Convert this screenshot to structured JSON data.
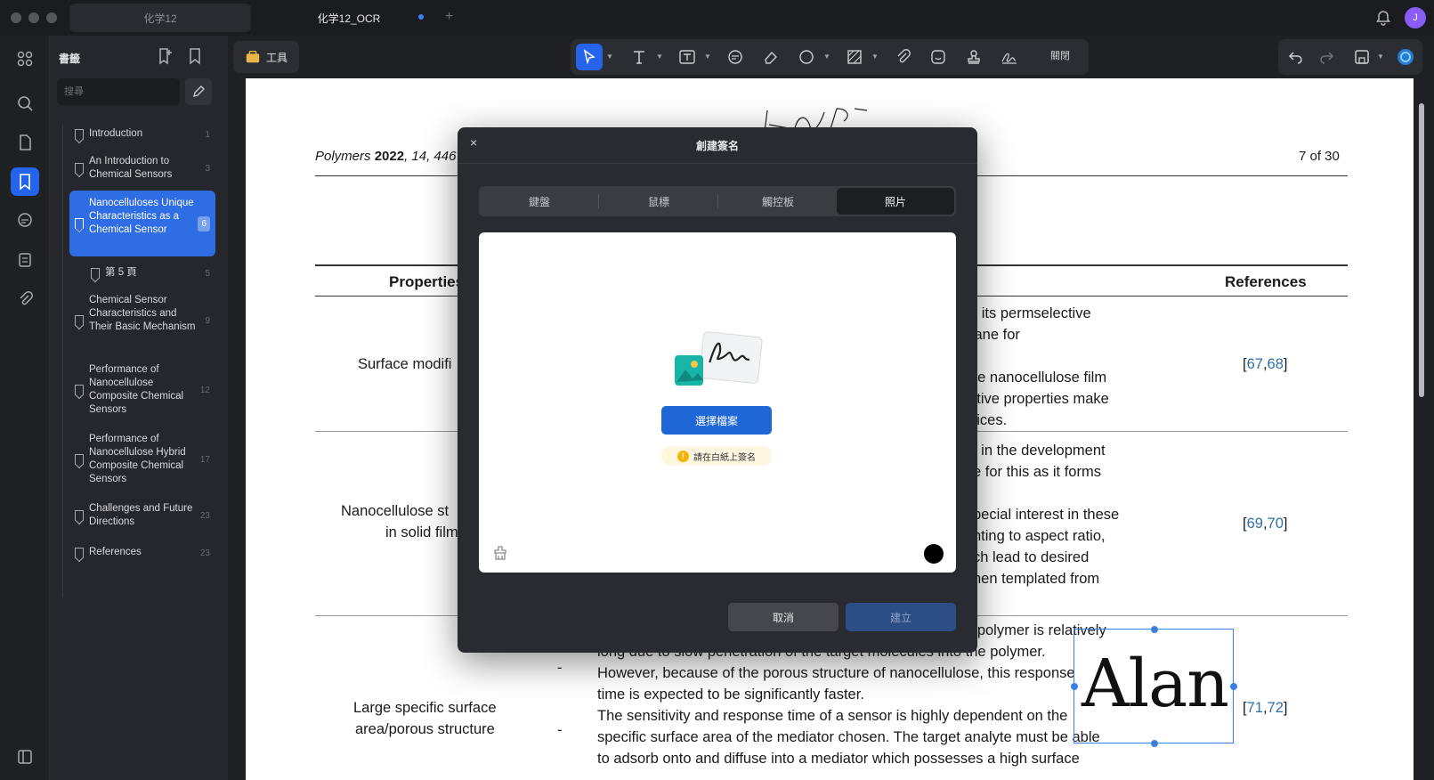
{
  "titlebar": {
    "tabs": [
      {
        "label": "化学12"
      },
      {
        "label": "化学12_OCR"
      }
    ],
    "avatar_initial": "J"
  },
  "sidebar": {
    "title": "書籤",
    "search_placeholder": "搜尋",
    "bookmarks": [
      {
        "label": "Introduction",
        "page": "1"
      },
      {
        "label": "An Introduction to Chemical Sensors",
        "page": "3"
      },
      {
        "label": "Nanocelluloses Unique Characteristics as a Chemical Sensor",
        "page": "6"
      },
      {
        "label": "第 5 頁",
        "page": "5"
      },
      {
        "label": "Chemical Sensor Characteristics and Their Basic Mechanism",
        "page": "9"
      },
      {
        "label": "Performance of Nanocellulose Composite Chemical Sensors",
        "page": "12"
      },
      {
        "label": "Performance of Nanocellulose Hybrid Composite Chemical Sensors",
        "page": "17"
      },
      {
        "label": "Challenges and Future Directions",
        "page": "23"
      },
      {
        "label": "References",
        "page": "23"
      }
    ]
  },
  "toolbar": {
    "tools_label": "工具",
    "close_label": "關閉"
  },
  "document": {
    "journal": "Polymers",
    "year": "2022",
    "volume": "14, 446",
    "page_of": "7 of 30",
    "col_properties": "Properties",
    "col_references": "References",
    "rows": [
      {
        "property": "Surface modifi",
        "text": [
          "d its permselective",
          "rane for",
          "",
          "he nanocellulose film",
          "ctive properties make",
          "vices."
        ],
        "refs": [
          "67",
          "68"
        ]
      },
      {
        "property": "Nanocellulose st",
        "property2": "in solid film",
        "text": [
          "t in the development",
          "e for this as it forms",
          "",
          "pecial interest in these",
          "nting to aspect ratio,",
          "ch lead to desired",
          "hen templated from"
        ],
        "refs": [
          "69",
          "70"
        ]
      },
      {
        "property": "Large specific surface",
        "property2": "area/porous structure",
        "text": [
          "k polymer is relatively",
          "long due to slow penetration of the target molecules into the polymer.",
          "However, because of the porous structure of nanocellulose, this response",
          "time is expected to be significantly faster.",
          "The sensitivity and response time of a sensor is highly dependent on the",
          "specific surface area of the mediator chosen. The target analyte must be able",
          "to adsorb onto and diffuse into a mediator which possesses a high surface"
        ],
        "refs": [
          "71",
          "72"
        ]
      }
    ],
    "signature_text": "Alan"
  },
  "modal": {
    "title": "創建簽名",
    "tabs": [
      "鍵盤",
      "鼠標",
      "觸控板",
      "照片"
    ],
    "selected_tab": "照片",
    "choose_file": "選擇檔案",
    "hint": "請在白紙上簽名",
    "cancel": "取消",
    "create": "建立",
    "pen_color": "#000000"
  },
  "colors": {
    "accent": "#2563eb",
    "link": "#2f6fa7"
  }
}
